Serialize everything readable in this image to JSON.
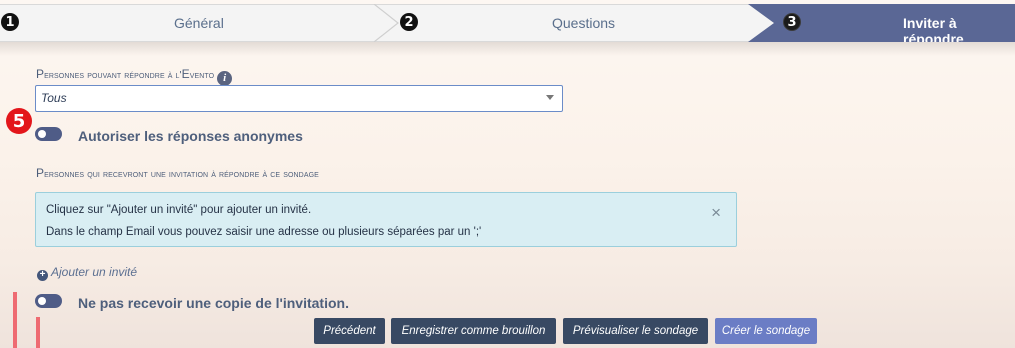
{
  "wizard": {
    "steps": [
      {
        "number": "1",
        "label": "Général"
      },
      {
        "number": "2",
        "label": "Questions"
      },
      {
        "number": "3",
        "label": "Inviter à répondre"
      }
    ]
  },
  "form": {
    "respondents": {
      "label_first": "P",
      "label_rest": "ersonnes pouvant répondre à l'",
      "label_e": "E",
      "label_end": "vento",
      "info_icon_text": "i",
      "select_value": "Tous"
    },
    "badge": "5",
    "anonymous_toggle_label": "Autoriser les réponses anonymes",
    "invitees": {
      "label_first": "P",
      "label_rest": "ersonnes qui recevront une invitation à répondre à ce sondage"
    },
    "alert": {
      "line1": "Cliquez sur \"Ajouter un invité\" pour ajouter un invité.",
      "line2": "Dans le champ Email vous pouvez saisir une adresse ou plusieurs séparées par un ';'",
      "close": "×"
    },
    "add_guest_label": "Ajouter un invité",
    "copy_toggle_label": "Ne pas recevoir une copie de l'invitation."
  },
  "buttons": {
    "previous": "Précédent",
    "save_draft": "Enregistrer comme brouillon",
    "preview": "Prévisualiser le sondage",
    "create": "Créer le sondage"
  },
  "colors": {
    "active_step": "#5a6795",
    "primary_button": "#384963",
    "accent_button": "#6b7dc5",
    "badge": "#e3161b",
    "alert_bg": "#d9eef3"
  }
}
